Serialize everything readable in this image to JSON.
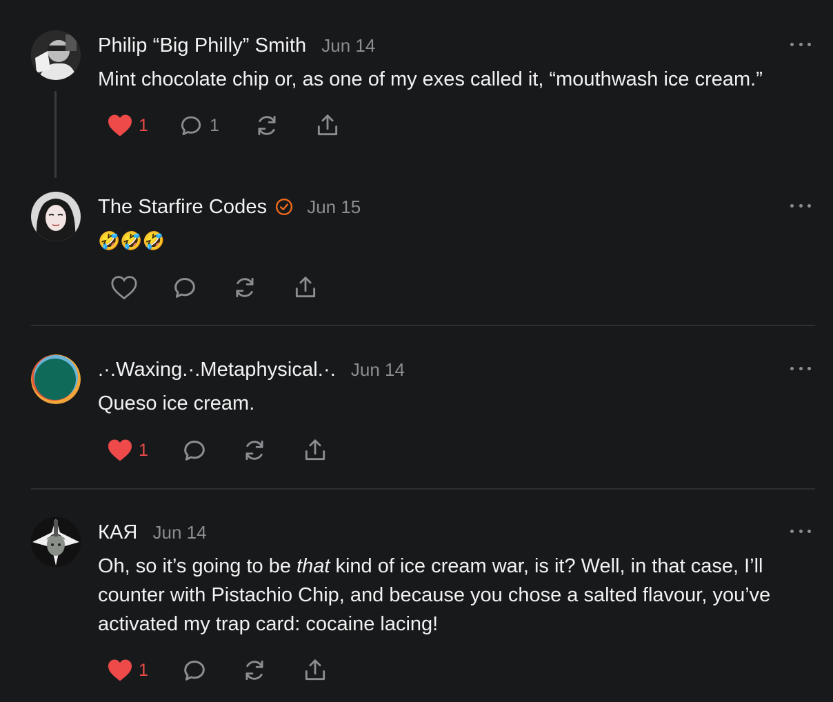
{
  "colors": {
    "background": "#18191b",
    "like_red": "#ef4a4a",
    "muted": "#8d8e92",
    "verified_orange": "#f26a1b"
  },
  "comments": [
    {
      "author": "Philip “Big Philly” Smith",
      "date": "Jun 14",
      "text": "Mint chocolate chip or, as one of my exes called it, “mouthwash ice cream.”",
      "likes": "1",
      "liked": true,
      "replies": "1"
    },
    {
      "author": "The Starfire Codes",
      "verified": true,
      "date": "Jun 15",
      "text": "🤣🤣🤣",
      "liked": false
    },
    {
      "author": ".·.Waxing.·.Metaphysical.·.",
      "date": "Jun 14",
      "text": "Queso ice cream.",
      "likes": "1",
      "liked": true
    },
    {
      "author": "КАЯ",
      "date": "Jun 14",
      "text_before": "Oh, so it’s going to be ",
      "text_italic": "that",
      "text_after": " kind of ice cream war, is it? Well, in that case, I’ll counter with Pistachio Chip, and because you chose a salted flavour, you’ve activated my trap card: cocaine lacing!",
      "likes": "1",
      "liked": true
    }
  ],
  "icons": {
    "like": "heart-icon",
    "reply": "comment-bubble-icon",
    "restack": "restack-icon",
    "share": "share-icon",
    "more": "more-dots-icon",
    "verified": "verified-badge-icon"
  }
}
